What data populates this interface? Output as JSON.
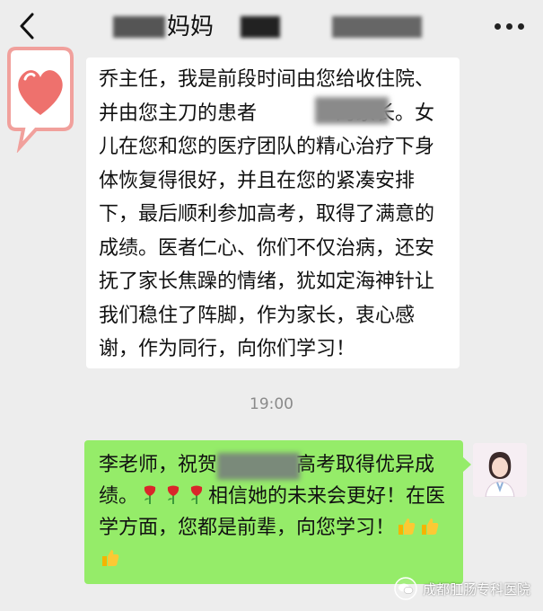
{
  "header": {
    "title": "妈妈",
    "back_icon": "chevron-left-icon",
    "more_icon": "more-dots-icon"
  },
  "messages": {
    "incoming": {
      "text": "乔主任，我是前段时间由您给收住院、并由您主刀的患者　　　　的家长。女儿在您和您的医疗团队的精心治疗下身体恢复得很好，并且在您的紧凑安排下，最后顺利参加高考，取得了满意的成绩。医者仁心、你们不仅治病，还安抚了家长焦躁的情绪，犹如定海神针让我们稳住了阵脚，作为家长，衷心感谢，作为同行，向你们学习！"
    },
    "timestamp": "19:00",
    "outgoing": {
      "part1": "李老师，祝贺　　　　高考取得优异成绩。",
      "part2": "相信她的未来会更好！在医学方面，您都是前辈，向您学习！"
    }
  },
  "watermark": {
    "text": "成都肛肠专科医院"
  },
  "colors": {
    "background": "#ededed",
    "incoming_bubble": "#ffffff",
    "outgoing_bubble": "#95ec69",
    "heart": "#f07f7c"
  }
}
